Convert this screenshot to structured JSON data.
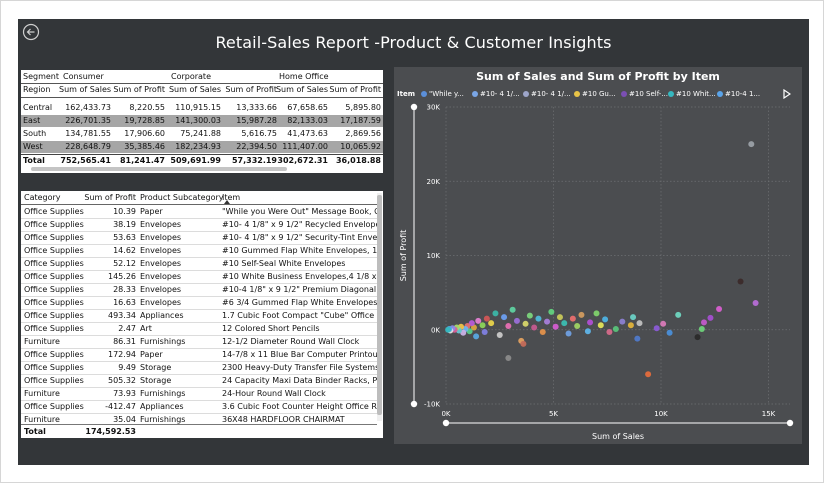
{
  "report": {
    "title": "Retail-Sales Report -Product & Customer Insights"
  },
  "matrix": {
    "segment_label": "Segment",
    "region_label": "Region",
    "segments": [
      "Consumer",
      "Corporate",
      "Home Office"
    ],
    "measures": [
      "Sum of Sales",
      "Sum of Profit",
      "Sum of Sales",
      "Sum of Profit",
      "Sum of Sales",
      "Sum of Profit"
    ],
    "rows": [
      {
        "region": "Central",
        "values": [
          "162,433.73",
          "8,220.55",
          "110,915.15",
          "13,333.66",
          "67,658.65",
          "5,895.80"
        ]
      },
      {
        "region": "East",
        "values": [
          "226,701.35",
          "19,728.85",
          "141,300.03",
          "15,987.28",
          "82,133.03",
          "17,187.59"
        ]
      },
      {
        "region": "South",
        "values": [
          "134,781.55",
          "17,906.60",
          "75,241.88",
          "5,616.75",
          "41,473.63",
          "2,869.56"
        ]
      },
      {
        "region": "West",
        "values": [
          "228,648.79",
          "35,385.46",
          "182,234.93",
          "22,394.50",
          "111,407.00",
          "10,065.92"
        ]
      }
    ],
    "total": {
      "label": "Total",
      "values": [
        "752,565.41",
        "81,241.47",
        "509,691.99",
        "57,332.19",
        "302,672.31",
        "36,018.88"
      ]
    }
  },
  "table": {
    "columns": [
      "Category",
      "Sum of Profit",
      "Product Subcategory",
      "Item"
    ],
    "rows": [
      [
        "Office Supplies",
        "10.39",
        "Paper",
        "\"While you Were Out\" Message Book, One"
      ],
      [
        "Office Supplies",
        "38.19",
        "Envelopes",
        "#10- 4 1/8\" x 9 1/2\" Recycled Envelopes"
      ],
      [
        "Office Supplies",
        "53.63",
        "Envelopes",
        "#10- 4 1/8\" x 9 1/2\" Security-Tint Envelope"
      ],
      [
        "Office Supplies",
        "14.62",
        "Envelopes",
        "#10 Gummed Flap White Envelopes, 100/B"
      ],
      [
        "Office Supplies",
        "52.12",
        "Envelopes",
        "#10 Self-Seal White Envelopes"
      ],
      [
        "Office Supplies",
        "145.26",
        "Envelopes",
        "#10 White Business Envelopes,4 1/8 x 9 1/"
      ],
      [
        "Office Supplies",
        "28.33",
        "Envelopes",
        "#10-4 1/8\" x 9 1/2\" Premium Diagonal Sea"
      ],
      [
        "Office Supplies",
        "16.63",
        "Envelopes",
        "#6 3/4 Gummed Flap White Envelopes"
      ],
      [
        "Office Supplies",
        "493.34",
        "Appliances",
        "1.7 Cubic Foot Compact \"Cube\" Office Ref"
      ],
      [
        "Office Supplies",
        "2.47",
        "Art",
        "12 Colored Short Pencils"
      ],
      [
        "Furniture",
        "86.31",
        "Furnishings",
        "12-1/2 Diameter Round Wall Clock"
      ],
      [
        "Office Supplies",
        "172.94",
        "Paper",
        "14-7/8 x 11 Blue Bar Computer Printout Pa"
      ],
      [
        "Office Supplies",
        "9.49",
        "Storage",
        "2300 Heavy-Duty Transfer File Systems by"
      ],
      [
        "Office Supplies",
        "505.32",
        "Storage",
        "24 Capacity Maxi Data Binder Racks, Pearl"
      ],
      [
        "Furniture",
        "73.93",
        "Furnishings",
        "24-Hour Round Wall Clock"
      ],
      [
        "Office Supplies",
        "-412.47",
        "Appliances",
        "3.6 Cubic Foot Counter Height Office Refri"
      ],
      [
        "Furniture",
        "35.04",
        "Furnishings",
        "36X48 HARDFLOOR CHAIRMAT"
      ]
    ],
    "total_label": "Total",
    "total_value": "174,592.53"
  },
  "scatter": {
    "title": "Sum of Sales and Sum of Profit by Item",
    "legend_title": "Item",
    "legend_items": [
      {
        "label": "\"While y...",
        "color": "#5b8fd9"
      },
      {
        "label": "#10- 4 1/...",
        "color": "#7aa6e6"
      },
      {
        "label": "#10- 4 1/...",
        "color": "#9da5c9"
      },
      {
        "label": "#10 Gu...",
        "color": "#e8c447"
      },
      {
        "label": "#10 Self-...",
        "color": "#7b4fb3"
      },
      {
        "label": "#10 Whit...",
        "color": "#35b8c0"
      },
      {
        "label": "#10-4 1...",
        "color": "#5aa4ea"
      }
    ]
  },
  "chart_data": {
    "type": "scatter",
    "title": "Sum of Sales and Sum of Profit by Item",
    "xlabel": "Sum of Sales",
    "ylabel": "Sum of Profit",
    "xlim": [
      0,
      16000
    ],
    "ylim": [
      -10000,
      30000
    ],
    "x_ticks": [
      "0K",
      "5K",
      "10K",
      "15K"
    ],
    "y_ticks": [
      "30K",
      "20K",
      "10K",
      "0K",
      "-10K"
    ],
    "grid": true,
    "legend_position": "top",
    "points": [
      {
        "x": 14200,
        "y": 25000,
        "color": "#9aa0a6"
      },
      {
        "x": 13700,
        "y": 6500,
        "color": "#3b2a2a"
      },
      {
        "x": 14400,
        "y": 3600,
        "color": "#b66dd6"
      },
      {
        "x": 12700,
        "y": 2800,
        "color": "#d75fd0"
      },
      {
        "x": 12300,
        "y": 1600,
        "color": "#a34fcf"
      },
      {
        "x": 12000,
        "y": 1000,
        "color": "#c05ac9"
      },
      {
        "x": 11900,
        "y": 100,
        "color": "#6ed27a"
      },
      {
        "x": 11700,
        "y": -1000,
        "color": "#2a2a2a"
      },
      {
        "x": 9400,
        "y": -6000,
        "color": "#e36c3c"
      },
      {
        "x": 10400,
        "y": -400,
        "color": "#4a8fd9"
      },
      {
        "x": 10100,
        "y": 800,
        "color": "#d87ab7"
      },
      {
        "x": 9800,
        "y": 200,
        "color": "#8a5bd6"
      },
      {
        "x": 9000,
        "y": 900,
        "color": "#c0c0c0"
      },
      {
        "x": 8700,
        "y": 1700,
        "color": "#6ad0c5"
      },
      {
        "x": 8600,
        "y": 600,
        "color": "#e0b33b"
      },
      {
        "x": 8200,
        "y": 1100,
        "color": "#8b7fd1"
      },
      {
        "x": 7900,
        "y": 100,
        "color": "#59c27a"
      },
      {
        "x": 7600,
        "y": -300,
        "color": "#d46a8a"
      },
      {
        "x": 7400,
        "y": 1400,
        "color": "#4db2e3"
      },
      {
        "x": 7200,
        "y": 600,
        "color": "#e3e35a"
      },
      {
        "x": 7000,
        "y": 2200,
        "color": "#7fd16b"
      },
      {
        "x": 6700,
        "y": 1000,
        "color": "#b04fd4"
      },
      {
        "x": 6600,
        "y": -200,
        "color": "#5fb4e8"
      },
      {
        "x": 6300,
        "y": 2000,
        "color": "#d19b5f"
      },
      {
        "x": 6100,
        "y": 500,
        "color": "#9fd163"
      },
      {
        "x": 5900,
        "y": 1500,
        "color": "#e86e6e"
      },
      {
        "x": 5700,
        "y": -500,
        "color": "#6f9fe0"
      },
      {
        "x": 5500,
        "y": 900,
        "color": "#3bbdb1"
      },
      {
        "x": 5300,
        "y": 1700,
        "color": "#c7c85a"
      },
      {
        "x": 5100,
        "y": 400,
        "color": "#d35cd0"
      },
      {
        "x": 4900,
        "y": 2400,
        "color": "#62d17e"
      },
      {
        "x": 4700,
        "y": 1100,
        "color": "#a57dd8"
      },
      {
        "x": 4500,
        "y": -300,
        "color": "#e3914b"
      },
      {
        "x": 4300,
        "y": 1500,
        "color": "#4fb8d8"
      },
      {
        "x": 4100,
        "y": 300,
        "color": "#c45a8f"
      },
      {
        "x": 3900,
        "y": 1900,
        "color": "#7bd47c"
      },
      {
        "x": 3700,
        "y": 800,
        "color": "#d6d66a"
      },
      {
        "x": 3500,
        "y": -1500,
        "color": "#e0a060"
      },
      {
        "x": 3300,
        "y": 1200,
        "color": "#9a6fd8"
      },
      {
        "x": 3100,
        "y": 2700,
        "color": "#5ed0a0"
      },
      {
        "x": 2900,
        "y": 500,
        "color": "#e66fb3"
      },
      {
        "x": 2700,
        "y": 1700,
        "color": "#6c9ef0"
      },
      {
        "x": 2500,
        "y": -700,
        "color": "#c9c9c9"
      },
      {
        "x": 2300,
        "y": 2200,
        "color": "#3bb6a6"
      },
      {
        "x": 2100,
        "y": 900,
        "color": "#e8d34b"
      },
      {
        "x": 1900,
        "y": 1500,
        "color": "#d05656"
      },
      {
        "x": 1800,
        "y": -300,
        "color": "#7f7fe0"
      },
      {
        "x": 1700,
        "y": 600,
        "color": "#8bd45a"
      },
      {
        "x": 1500,
        "y": 1200,
        "color": "#e27fd2"
      },
      {
        "x": 1400,
        "y": -900,
        "color": "#59a8e0"
      },
      {
        "x": 1300,
        "y": 300,
        "color": "#d9a441"
      },
      {
        "x": 1200,
        "y": 900,
        "color": "#b65bd9"
      },
      {
        "x": 1100,
        "y": -200,
        "color": "#56c98a"
      },
      {
        "x": 1000,
        "y": 500,
        "color": "#e27070"
      },
      {
        "x": 900,
        "y": 100,
        "color": "#6fb5ee"
      },
      {
        "x": 800,
        "y": -400,
        "color": "#c9b1e6"
      },
      {
        "x": 700,
        "y": 400,
        "color": "#f0c24a"
      },
      {
        "x": 600,
        "y": -100,
        "color": "#67c6d4"
      },
      {
        "x": 500,
        "y": 300,
        "color": "#a3d96a"
      },
      {
        "x": 400,
        "y": 0,
        "color": "#d75f97"
      },
      {
        "x": 300,
        "y": 200,
        "color": "#8c8ce6"
      },
      {
        "x": 200,
        "y": -100,
        "color": "#e0e0e0"
      },
      {
        "x": 150,
        "y": 100,
        "color": "#5aa4ea"
      },
      {
        "x": 100,
        "y": 0,
        "color": "#35b8c0"
      },
      {
        "x": 2900,
        "y": -3800,
        "color": "#8a8a8a"
      },
      {
        "x": 3600,
        "y": -1900,
        "color": "#c46b5a"
      },
      {
        "x": 8900,
        "y": -1200,
        "color": "#4f79c9"
      },
      {
        "x": 10800,
        "y": 2000,
        "color": "#6fd6c0"
      }
    ]
  }
}
